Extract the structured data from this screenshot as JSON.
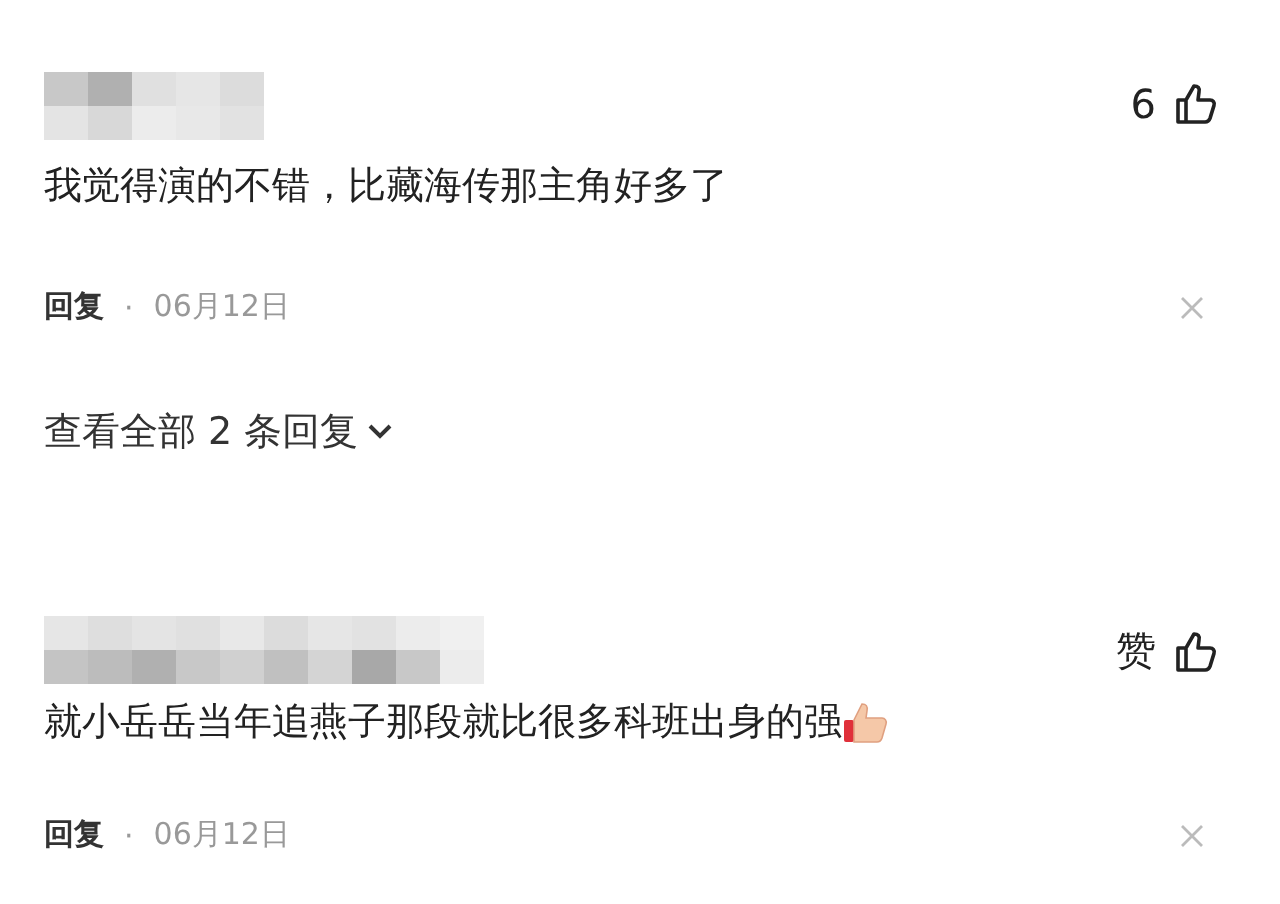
{
  "comments": [
    {
      "likes": "6",
      "text": "我觉得演的不错，比藏海传那主角好多了",
      "trailing_emoji": false,
      "reply_label": "回复",
      "separator": "·",
      "date": "06月12日",
      "replies_link": "查看全部 2 条回复"
    },
    {
      "likes": "赞",
      "text": "就小岳岳当年追燕子那段就比很多科班出身的强",
      "trailing_emoji": true,
      "reply_label": "回复",
      "separator": "·",
      "date": "06月12日"
    }
  ]
}
